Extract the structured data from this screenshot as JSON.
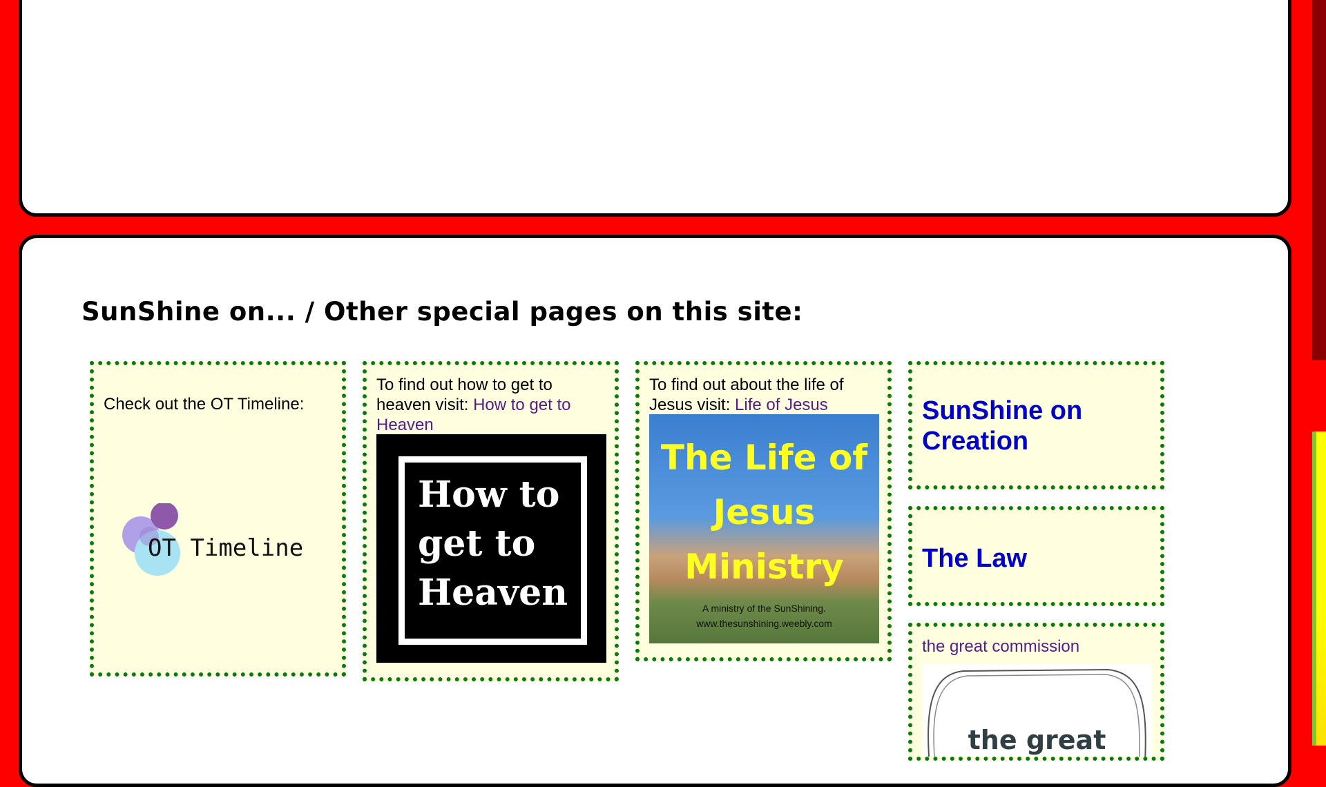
{
  "section": {
    "heading": "SunShine on... / Other special pages on this site:"
  },
  "cards": {
    "ot_timeline": {
      "text": "Check out the OT Timeline:",
      "logo_text": "OT Timeline"
    },
    "heaven": {
      "text": "To find out how to get to heaven visit: ",
      "link": "How to get to Heaven",
      "image_title": "How to get to Heaven"
    },
    "jesus": {
      "text": "To find out about the life of Jesus visit: ",
      "link": "Life of Jesus",
      "image_title": "The Life of Jesus Ministry",
      "image_credit_1": "A ministry of the SunShining.",
      "image_credit_2": "www.thesunshining.weebly.com"
    },
    "creation": {
      "link": "SunShine on Creation"
    },
    "law": {
      "link": "The Law"
    },
    "commission": {
      "link": "the great commission",
      "image_text": "the great"
    }
  },
  "colors": {
    "background": "#ff0000",
    "card_fill": "#ffffe0",
    "card_border": "#0a7a0a",
    "link_visited": "#551a8b",
    "link_big": "#0000cc"
  }
}
